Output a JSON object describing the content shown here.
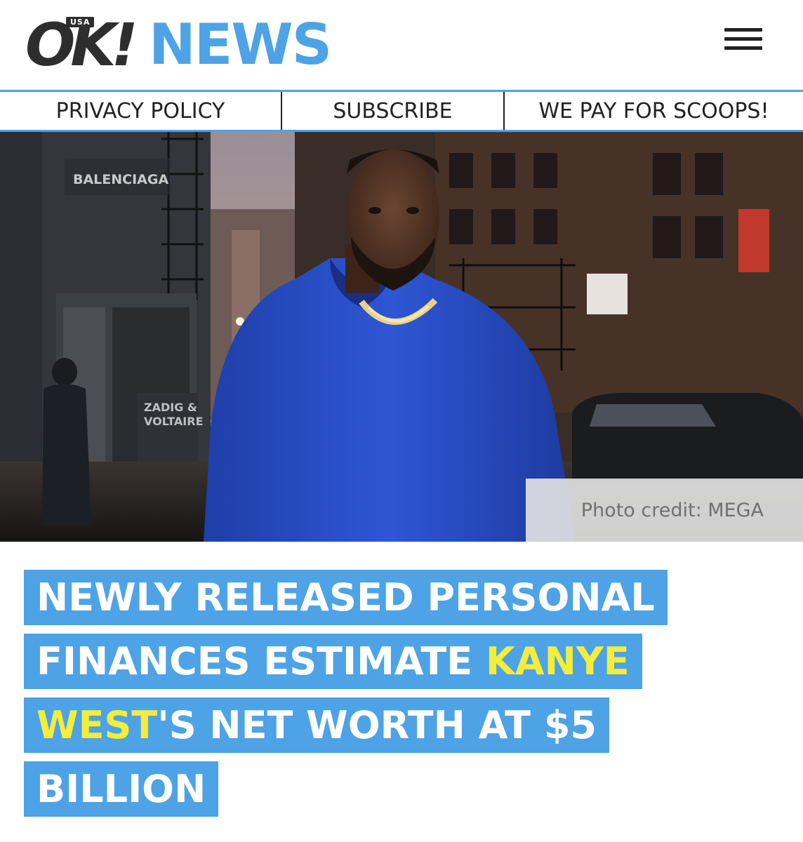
{
  "header": {
    "logo_ok": "OK!",
    "logo_usa": "USA",
    "logo_news": "NEWS",
    "menu_icon": "hamburger-menu-icon"
  },
  "nav": {
    "items": [
      {
        "label": "PRIVACY POLICY"
      },
      {
        "label": "SUBSCRIBE"
      },
      {
        "label": "WE PAY FOR SCOOPS!"
      }
    ]
  },
  "hero": {
    "caption": "Photo credit: MEGA",
    "signs": {
      "balenciaga": "BALENCIAGA",
      "zadig": "ZADIG &",
      "voltaire": "VOLTAIRE"
    }
  },
  "headline": {
    "before": "NEWLY RELEASED PERSONAL FINANCES ESTIMATE ",
    "highlight": "KANYE WEST",
    "after": "'S NET WORTH AT $5 BILLION"
  },
  "colors": {
    "brand_blue": "#4da3e5",
    "highlight_yellow": "#f3ee3b",
    "logo_dark": "#2e2e2e"
  }
}
